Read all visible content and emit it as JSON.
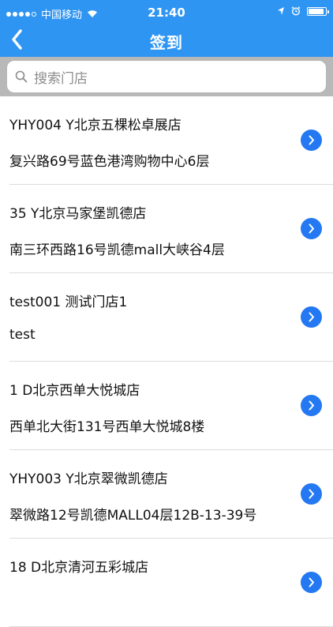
{
  "status_bar": {
    "carrier": "中国移动",
    "time": "21:40",
    "battery_level": 0.9
  },
  "nav": {
    "title": "签到",
    "back_icon": "chevron-left-icon"
  },
  "search": {
    "placeholder": "搜索门店",
    "icon": "search-icon"
  },
  "colors": {
    "header": "#2f95f3",
    "search_bg": "#b8b8b8",
    "go_button": "#2478f2"
  },
  "stores": [
    {
      "name": "YHY004  Y北京五棵松卓展店",
      "address": "复兴路69号蓝色港湾购物中心6层"
    },
    {
      "name": "35  Y北京马家堡凯德店",
      "address": "南三环西路16号凯德mall大峡谷4层"
    },
    {
      "name": "test001  测试门店1",
      "address": "test"
    },
    {
      "name": "1  D北京西单大悦城店",
      "address": "西单北大街131号西单大悦城8楼"
    },
    {
      "name": "YHY003  Y北京翠微凯德店",
      "address": "翠微路12号凯德MALL04层12B-13-39号"
    },
    {
      "name": "18  D北京清河五彩城店",
      "address": ""
    }
  ]
}
